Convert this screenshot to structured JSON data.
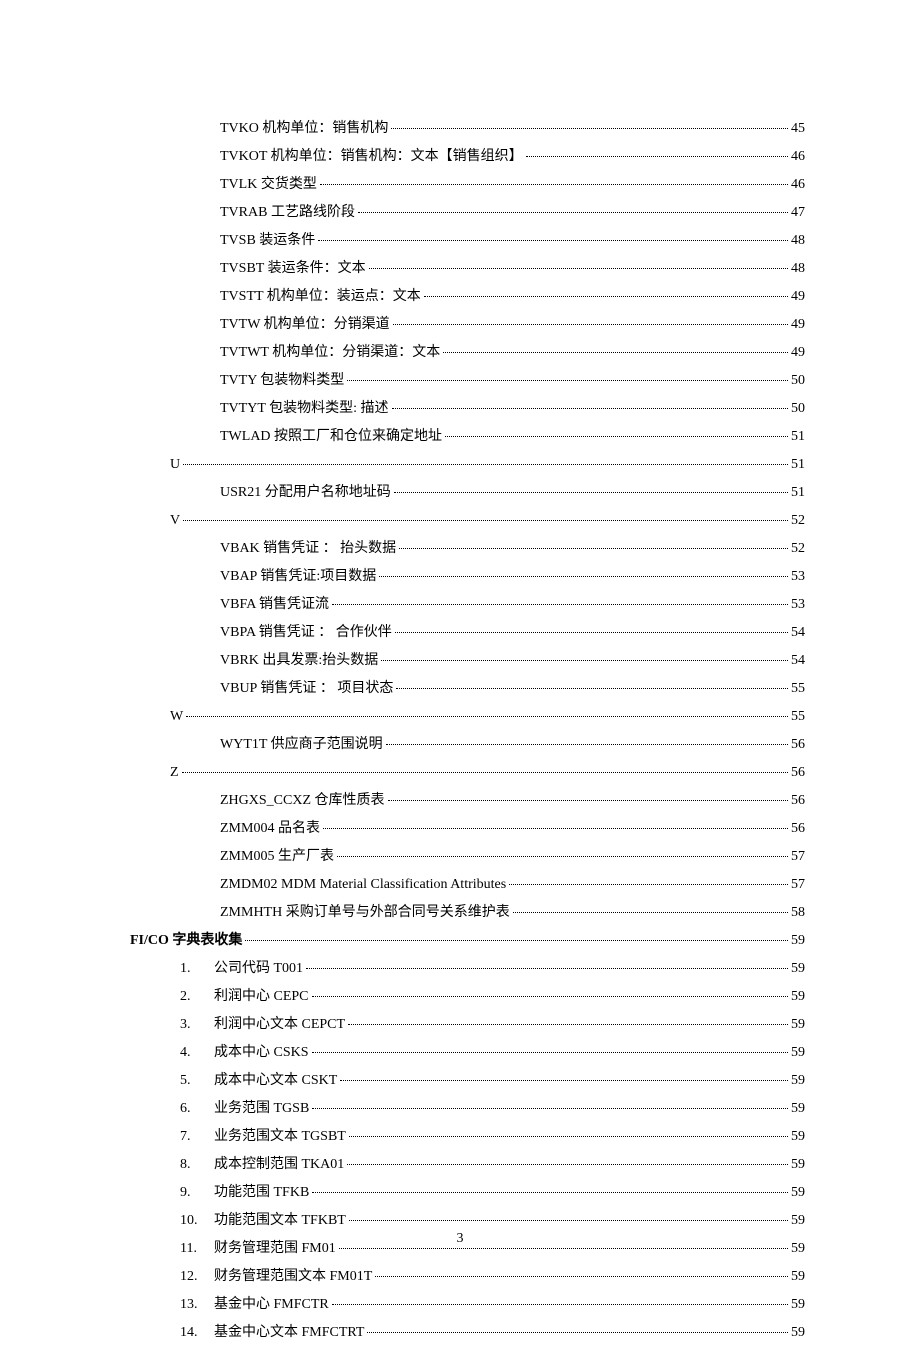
{
  "page_number": "3",
  "toc": [
    {
      "level": 3,
      "label": "TVKO 机构单位：销售机构",
      "page": "45"
    },
    {
      "level": 3,
      "label": "TVKOT 机构单位：销售机构：文本【销售组织】",
      "page": "46"
    },
    {
      "level": 3,
      "label": "TVLK   交货类型",
      "page": "46"
    },
    {
      "level": 3,
      "label": "TVRAB 工艺路线阶段",
      "page": "47"
    },
    {
      "level": 3,
      "label": "TVSB   装运条件",
      "page": "48"
    },
    {
      "level": 3,
      "label": "TVSBT 装运条件：文本",
      "page": "48"
    },
    {
      "level": 3,
      "label": "TVSTT 机构单位：装运点：文本",
      "page": "49"
    },
    {
      "level": 3,
      "label": "TVTW 机构单位：分销渠道",
      "page": "49"
    },
    {
      "level": 3,
      "label": "TVTWT 机构单位：分销渠道：文本",
      "page": "49"
    },
    {
      "level": 3,
      "label": "TVTY 包装物料类型",
      "page": "50"
    },
    {
      "level": 3,
      "label": "TVTYT 包装物料类型: 描述",
      "page": "50"
    },
    {
      "level": 3,
      "label": "TWLAD 按照工厂和仓位来确定地址",
      "page": "51"
    },
    {
      "level": 1,
      "label": "U",
      "page": "51"
    },
    {
      "level": 3,
      "label": "USR21 分配用户名称地址码",
      "page": "51"
    },
    {
      "level": 1,
      "label": "V",
      "page": "52"
    },
    {
      "level": 3,
      "label": "VBAK 销售凭证 ：  抬头数据",
      "page": "52"
    },
    {
      "level": 3,
      "label": "VBAP  销售凭证:项目数据",
      "page": "53"
    },
    {
      "level": 3,
      "label": "VBFA  销售凭证流",
      "page": "53"
    },
    {
      "level": 3,
      "label": "VBPA  销售凭证 ：  合作伙伴",
      "page": "54"
    },
    {
      "level": 3,
      "label": "VBRK  出具发票:抬头数据",
      "page": "54"
    },
    {
      "level": 3,
      "label": "VBUP 销售凭证 ：  项目状态",
      "page": "55"
    },
    {
      "level": 1,
      "label": "W",
      "page": "55"
    },
    {
      "level": 3,
      "label": "WYT1T 供应商子范围说明",
      "page": "56"
    },
    {
      "level": 1,
      "label": "Z",
      "page": "56"
    },
    {
      "level": 3,
      "label": "ZHGXS_CCXZ 仓库性质表",
      "page": "56"
    },
    {
      "level": 3,
      "label": "ZMM004 品名表",
      "page": "56"
    },
    {
      "level": 3,
      "label": "ZMM005 生产厂表",
      "page": "57"
    },
    {
      "level": 3,
      "label": "ZMDM02 MDM Material Classification Attributes",
      "page": "57"
    },
    {
      "level": 3,
      "label": "ZMMHTH 采购订单号与外部合同号关系维护表",
      "page": "58"
    },
    {
      "level": 0,
      "label": "FI/CO 字典表收集",
      "page": "59",
      "bold": true
    },
    {
      "level": 2,
      "marker": "1.",
      "label": "公司代码 T001",
      "page": "59"
    },
    {
      "level": 2,
      "marker": "2.",
      "label": "利润中心 CEPC",
      "page": "59"
    },
    {
      "level": 2,
      "marker": "3.",
      "label": "利润中心文本 CEPCT",
      "page": "59"
    },
    {
      "level": 2,
      "marker": "4.",
      "label": "成本中心 CSKS",
      "page": "59"
    },
    {
      "level": 2,
      "marker": "5.",
      "label": "成本中心文本 CSKT",
      "page": "59"
    },
    {
      "level": 2,
      "marker": "6.",
      "label": "业务范围 TGSB",
      "page": "59"
    },
    {
      "level": 2,
      "marker": "7.",
      "label": "业务范围文本 TGSBT",
      "page": "59"
    },
    {
      "level": 2,
      "marker": "8.",
      "label": "成本控制范围 TKA01",
      "page": "59"
    },
    {
      "level": 2,
      "marker": "9.",
      "label": "功能范围 TFKB",
      "page": "59"
    },
    {
      "level": 2,
      "marker": "10.",
      "label": "功能范围文本 TFKBT",
      "page": "59"
    },
    {
      "level": 2,
      "marker": "11.",
      "label": "财务管理范围 FM01",
      "page": "59"
    },
    {
      "level": 2,
      "marker": "12.",
      "label": "财务管理范围文本 FM01T",
      "page": "59"
    },
    {
      "level": 2,
      "marker": "13.",
      "label": "基金中心 FMFCTR",
      "page": "59"
    },
    {
      "level": 2,
      "marker": "14.",
      "label": "基金中心文本 FMFCTRT",
      "page": "59"
    }
  ]
}
